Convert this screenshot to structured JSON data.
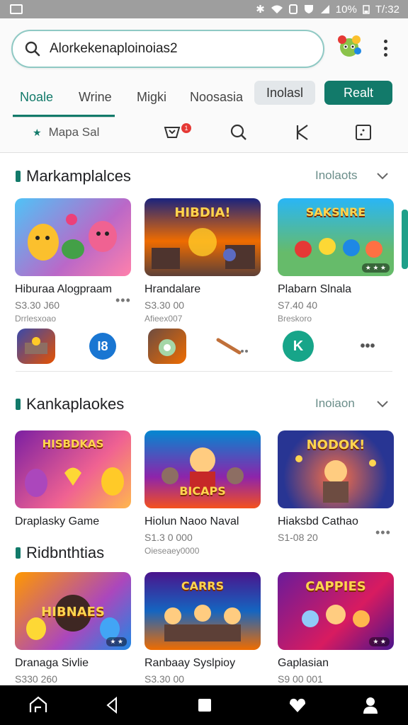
{
  "status_bar": {
    "battery": "10%",
    "time": "T/:32"
  },
  "search": {
    "value": "Alorkekenaploinoias2"
  },
  "tabs": [
    {
      "label": "Noale"
    },
    {
      "label": "Wrine"
    },
    {
      "label": "Migki"
    },
    {
      "label": "Noosasia"
    }
  ],
  "chips": {
    "secondary": "Inolasl",
    "primary": "Realt"
  },
  "filter_bar": {
    "location_label": "Mapa Sal",
    "notification_count": "1"
  },
  "sections": [
    {
      "title": "Markamplalces",
      "more": "Inolaots",
      "cards": [
        {
          "art": "",
          "name": "Hiburaa Alogpraam",
          "price": "S3.30 J60",
          "sub": "Drrlesxoao",
          "dots": "•••"
        },
        {
          "art": "HIBDIA!",
          "name": "Hrandalare",
          "price": "S3.30 00",
          "sub": "Afieex007",
          "dots": ""
        },
        {
          "art": "SAKSNRE",
          "name": "Plabarn Slnala",
          "price": "S7.40 40",
          "sub": "Breskoro",
          "dots": ""
        }
      ],
      "mini_apps": [
        "",
        "I8",
        "",
        "",
        "K",
        "•••"
      ]
    },
    {
      "title": "Kankaplaokes",
      "more": "Inoiaon",
      "cards": [
        {
          "art": "HISBDKAS",
          "name": "Draplasky Game",
          "price": "",
          "sub": "",
          "dots": ""
        },
        {
          "art": "BICAPS",
          "name": "Hiolun Naoo Naval",
          "price": "S1.3 0 000",
          "sub": "Oieseaey0000",
          "dots": ""
        },
        {
          "art": "NODOK!",
          "name": "Hiaksbd Cathao",
          "price": "S1-08 20",
          "sub": "",
          "dots": "•••"
        }
      ]
    },
    {
      "title": "Ridbnthtias",
      "cards": [
        {
          "art": "HIBNAES",
          "name": "Dranaga Sivlie",
          "price": "S330 260",
          "sub": "",
          "dots": ""
        },
        {
          "art": "CARRS",
          "name": "Ranbaay Syslpioy",
          "price": "S3.30 00",
          "sub": "",
          "dots": ""
        },
        {
          "art": "CAPPIES",
          "name": "Gaplasian",
          "price": "S9 00 001",
          "sub": "",
          "dots": ""
        }
      ]
    }
  ]
}
